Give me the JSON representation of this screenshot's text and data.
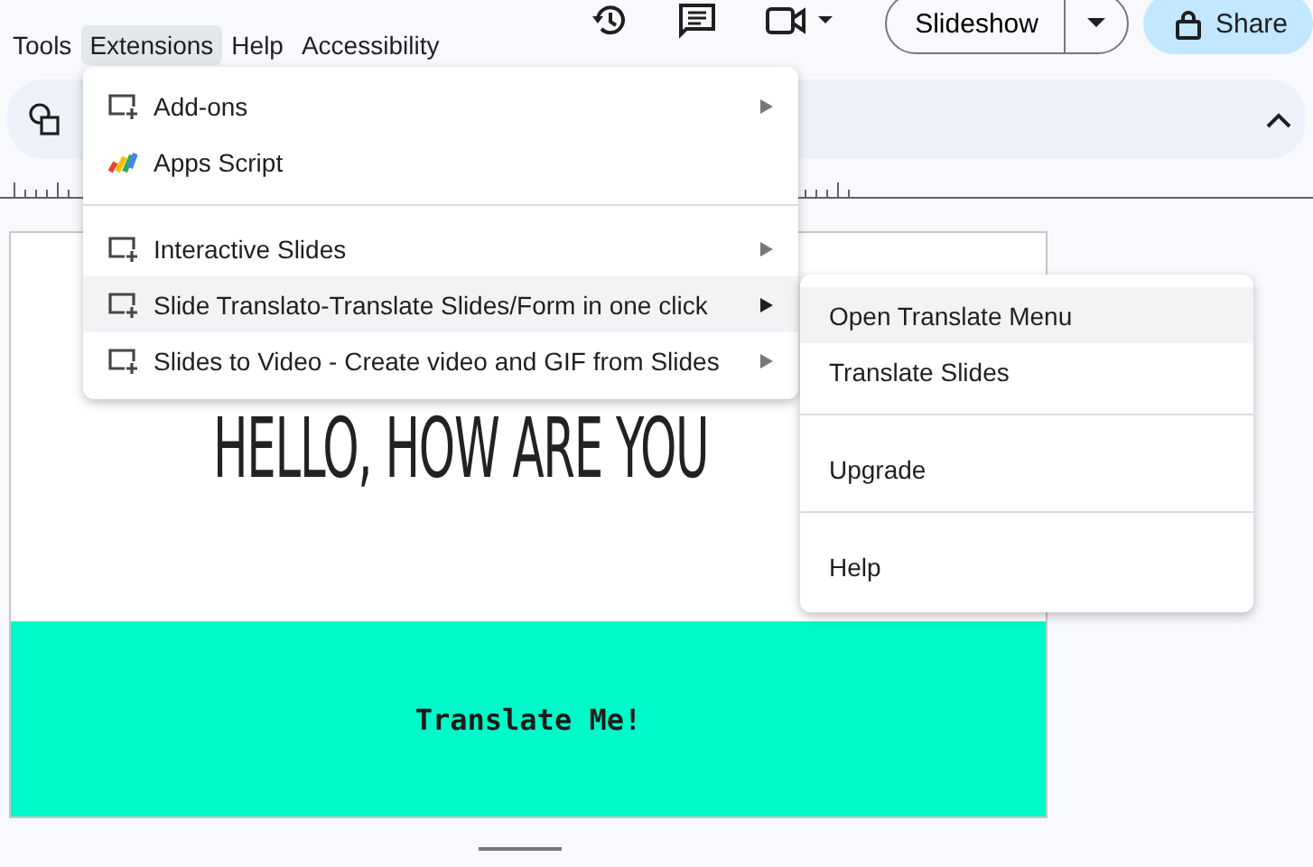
{
  "menubar": [
    {
      "label": "Tools",
      "selected": false
    },
    {
      "label": "Extensions",
      "selected": true
    },
    {
      "label": "Help",
      "selected": false
    },
    {
      "label": "Accessibility",
      "selected": false
    }
  ],
  "top_actions": {
    "slideshow": "Slideshow",
    "share": "Share"
  },
  "extensions_menu": {
    "groups": [
      [
        {
          "kind": "addon",
          "label": "Add-ons",
          "has_submenu": true,
          "selected": false
        },
        {
          "kind": "script",
          "label": "Apps Script",
          "has_submenu": false,
          "selected": false
        }
      ],
      [
        {
          "kind": "addon",
          "label": "Interactive Slides",
          "has_submenu": true,
          "selected": false
        },
        {
          "kind": "addon",
          "label": "Slide Translato-Translate Slides/Form in one click",
          "has_submenu": true,
          "selected": true
        },
        {
          "kind": "addon",
          "label": "Slides to Video - Create video and GIF from Slides",
          "has_submenu": true,
          "selected": false
        }
      ]
    ]
  },
  "submenu": {
    "groups": [
      [
        {
          "label": "Open Translate Menu",
          "selected": true
        },
        {
          "label": "Translate Slides",
          "selected": false
        }
      ],
      [
        {
          "label": "Upgrade",
          "selected": false
        }
      ],
      [
        {
          "label": "Help",
          "selected": false
        }
      ]
    ]
  },
  "slide": {
    "title": "HELLO, HOW ARE YOU",
    "banner_text": "Translate Me!"
  }
}
